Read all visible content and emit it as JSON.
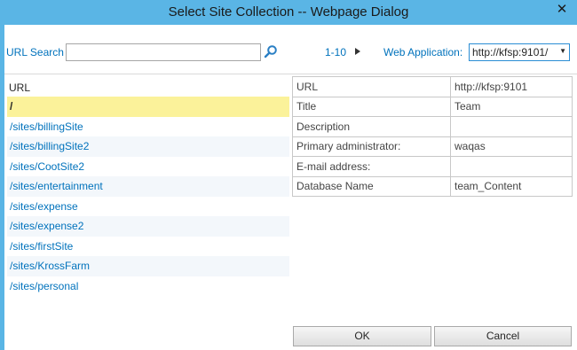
{
  "window": {
    "title": "Select Site Collection -- Webpage Dialog",
    "close_glyph": "✕",
    "accent": "#5ab5e5"
  },
  "toolbar": {
    "search_label": "URL Search",
    "search_value": "",
    "search_icon": "magnifier-icon",
    "paging_label": "1-10",
    "next_icon": "next-page-icon",
    "webapp_label": "Web Application:",
    "webapp_value": "http://kfsp:9101/",
    "dropdown_glyph": "▼"
  },
  "url_list": {
    "header": "URL",
    "items": [
      "/",
      "/sites/billingSite",
      "/sites/billingSite2",
      "/sites/CootSite2",
      "/sites/entertainment",
      "/sites/expense",
      "/sites/expense2",
      "/sites/firstSite",
      "/sites/KrossFarm",
      "/sites/personal"
    ],
    "selected_index": 0
  },
  "properties": [
    {
      "key": "URL",
      "value": "http://kfsp:9101"
    },
    {
      "key": "Title",
      "value": "Team"
    },
    {
      "key": "Description",
      "value": ""
    },
    {
      "key": "Primary administrator:",
      "value": "waqas"
    },
    {
      "key": "E-mail address:",
      "value": ""
    },
    {
      "key": "Database Name",
      "value": "team_Content"
    }
  ],
  "buttons": {
    "ok_label": "OK",
    "cancel_label": "Cancel"
  }
}
